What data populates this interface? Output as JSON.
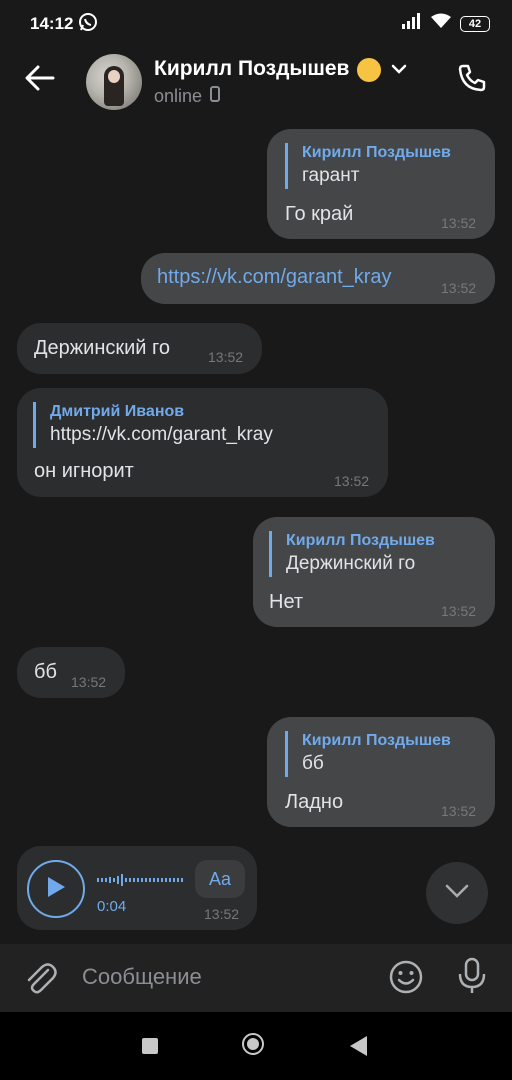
{
  "status_bar": {
    "time": "14:12",
    "battery": "42"
  },
  "header": {
    "name": "Кирилл Поздышев",
    "status": "online"
  },
  "messages": [
    {
      "reply_name": "Кирилл Поздышев",
      "reply_text": "гарант",
      "text": "Го край",
      "time": "13:52"
    },
    {
      "text": "https://vk.com/garant_kray",
      "time": "13:52"
    },
    {
      "text": "Держинский го",
      "time": "13:52"
    },
    {
      "reply_name": "Дмитрий Иванов",
      "reply_text": "https://vk.com/garant_kray",
      "text": "он игнорит",
      "time": "13:52"
    },
    {
      "reply_name": "Кирилл Поздышев",
      "reply_text": "Держинский го",
      "text": "Нет",
      "time": "13:52"
    },
    {
      "text": "бб",
      "time": "13:52"
    },
    {
      "reply_name": "Кирилл Поздышев",
      "reply_text": "бб",
      "text": "Ладно",
      "time": "13:52"
    }
  ],
  "voice": {
    "duration": "0:04",
    "transcribe_label": "Aa",
    "time": "13:52"
  },
  "composer": {
    "placeholder": "Сообщение"
  },
  "icons": {
    "back": "arrow-left-icon",
    "call": "phone-icon",
    "attach": "paperclip-icon",
    "emoji": "smiley-icon",
    "mic": "microphone-icon",
    "scroll": "chevron-down-icon",
    "play": "play-icon",
    "whatsapp": "whatsapp-icon",
    "signal": "signal-icon",
    "wifi": "wifi-icon"
  },
  "colors": {
    "accent": "#71aaeb",
    "background": "#19191a",
    "bubble_out": "#454647",
    "bubble_in": "#2c2d2e"
  }
}
